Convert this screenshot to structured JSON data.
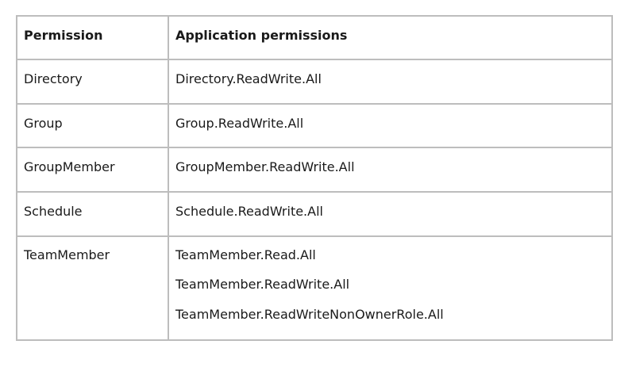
{
  "table": {
    "headers": [
      "Permission",
      "Application permissions"
    ],
    "rows": [
      {
        "permission": "Directory",
        "application_permissions": [
          "Directory.ReadWrite.All"
        ]
      },
      {
        "permission": "Group",
        "application_permissions": [
          "Group.ReadWrite.All"
        ]
      },
      {
        "permission": "GroupMember",
        "application_permissions": [
          "GroupMember.ReadWrite.All"
        ]
      },
      {
        "permission": "Schedule",
        "application_permissions": [
          "Schedule.ReadWrite.All"
        ]
      },
      {
        "permission": "TeamMember",
        "application_permissions": [
          "TeamMember.Read.All",
          "TeamMember.ReadWrite.All",
          "TeamMember.ReadWriteNonOwnerRole.All"
        ]
      }
    ]
  }
}
